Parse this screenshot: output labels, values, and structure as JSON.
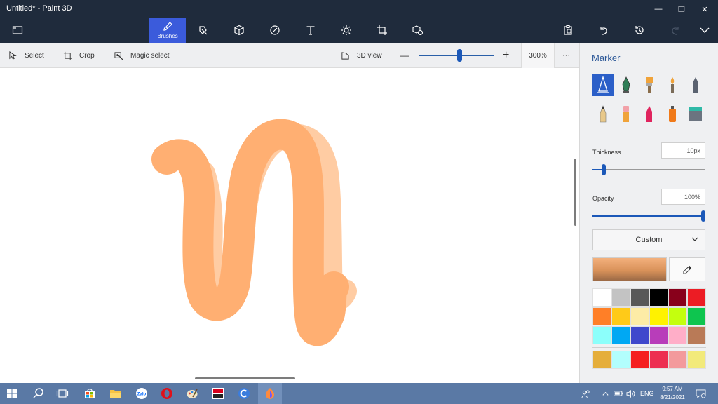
{
  "window": {
    "title": "Untitled* - Paint 3D",
    "minimize_glyph": "—",
    "maximize_glyph": "❐",
    "close_glyph": "✕"
  },
  "toolbar": {
    "tabs": [
      {
        "id": "menu",
        "icon": "folder-icon"
      },
      {
        "id": "brushes",
        "label": "Brushes",
        "icon": "brush-icon"
      },
      {
        "id": "2d-shapes",
        "icon": "2d-shapes-icon"
      },
      {
        "id": "3d-shapes",
        "icon": "cube-icon"
      },
      {
        "id": "stickers",
        "icon": "sticker-icon"
      },
      {
        "id": "text",
        "icon": "text-icon"
      },
      {
        "id": "effects",
        "icon": "sun-icon"
      },
      {
        "id": "canvas",
        "icon": "canvas-crop-icon"
      },
      {
        "id": "3d-library",
        "icon": "3d-library-icon"
      }
    ],
    "right_actions": [
      "paste-icon",
      "undo-icon",
      "history-icon",
      "redo-icon",
      "expand-chevron-icon"
    ]
  },
  "subtoolbar": {
    "select_label": "Select",
    "crop_label": "Crop",
    "magic_select_label": "Magic select",
    "view3d_label": "3D view",
    "zoom_minus": "—",
    "zoom_plus": "+",
    "zoom_value": "300%",
    "more": "···"
  },
  "canvas": {
    "stroke_color_main": "#FFAF72",
    "stroke_color_light": "#FFCCA3"
  },
  "panel": {
    "title": "Marker",
    "brushes": [
      "marker",
      "calligraphy-pen",
      "oil-brush",
      "watercolor",
      "pixel-pen",
      "pencil",
      "eraser",
      "crayon",
      "spray-can",
      "fill-bucket"
    ],
    "selected_brush": "marker",
    "thickness_label": "Thickness",
    "thickness_value": "10px",
    "thickness_fraction": 0.1,
    "opacity_label": "Opacity",
    "opacity_value": "100%",
    "opacity_fraction": 1.0,
    "color_mode": "Custom",
    "palette": [
      "#FFFFFF",
      "#C3C3C3",
      "#585858",
      "#000000",
      "#88001B",
      "#EC1C24",
      "#FF7F27",
      "#FFCA18",
      "#FDECA6",
      "#FFF200",
      "#C4FF0E",
      "#0EC54F",
      "#8CFFFB",
      "#00A8F3",
      "#3F48CC",
      "#B83DBA",
      "#FFAEC8",
      "#B97A57"
    ],
    "custom_palette": [
      "#E5AE3B",
      "#B2FEFD",
      "#F51E1F",
      "#ED2E51",
      "#F39A9C",
      "#F2EA7A"
    ]
  },
  "taskbar": {
    "apps": [
      "windows-start-icon",
      "search-icon",
      "task-view-icon",
      "store-icon",
      "file-explorer-icon",
      "zalo-icon",
      "opera-icon",
      "paint-icon",
      "media-app-icon",
      "coccoc-icon",
      "paint3d-icon"
    ],
    "zalo_label": "Zalo",
    "language": "ENG",
    "time": "9:57 AM",
    "date": "8/21/2021"
  }
}
